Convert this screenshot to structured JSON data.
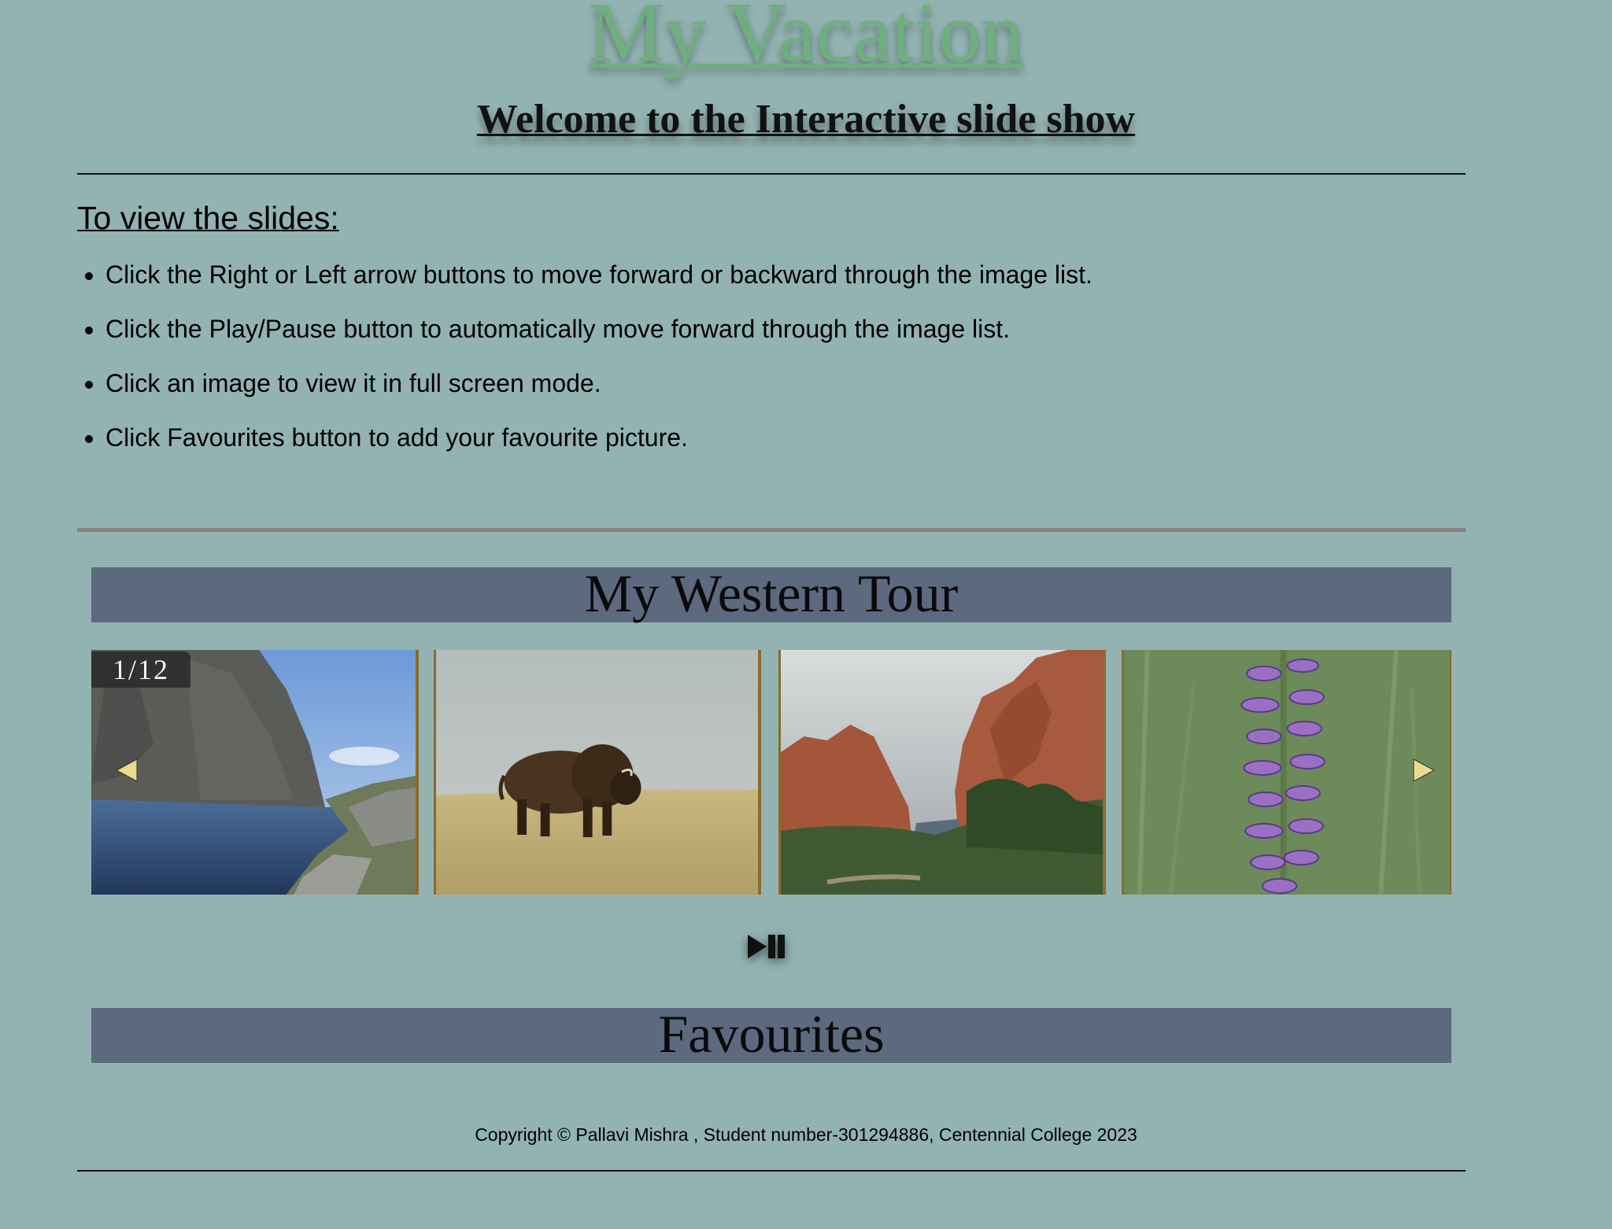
{
  "header": {
    "title": "My Vacation",
    "subtitle": "Welcome to the Interactive slide show"
  },
  "instructions": {
    "heading": "To view the slides:",
    "items": [
      "Click the Right or Left arrow buttons to move forward or backward through the image list.",
      "Click the Play/Pause button to automatically move forward through the image list.",
      "Click an image to view it in full screen mode.",
      "Click Favourites button to add your favourite picture."
    ]
  },
  "slideshow": {
    "title": "My Western Tour",
    "counter": "1/12",
    "current": 1,
    "total": 12,
    "visible_slides": [
      {
        "icon": "lake-mountain-photo"
      },
      {
        "icon": "bison-photo"
      },
      {
        "icon": "red-rocks-photo"
      },
      {
        "icon": "purple-flower-photo"
      }
    ],
    "prev_icon": "arrow-left-icon",
    "next_icon": "arrow-right-icon",
    "play_pause_icon": "play-pause-icon"
  },
  "favourites": {
    "title": "Favourites"
  },
  "footer": {
    "copyright": "Copyright © Pallavi Mishra , Student number-301294886, Centennial College 2023"
  },
  "colors": {
    "background": "#93b3b3",
    "title_green": "#6fae7f",
    "banner": "#5c697e",
    "arrow": "#e9dc8c",
    "frame": "#8c6a2c"
  }
}
